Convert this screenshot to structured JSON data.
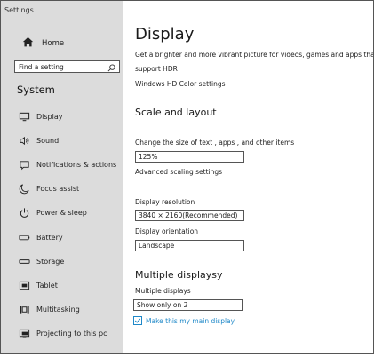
{
  "window": {
    "title": "Settings"
  },
  "sidebar": {
    "home_label": "Home",
    "search_placeholder": "Find a setting",
    "section_title": "System",
    "items": [
      {
        "label": "Display",
        "icon": "monitor-icon"
      },
      {
        "label": "Sound",
        "icon": "speaker-icon"
      },
      {
        "label": "Notifications & actions",
        "icon": "notification-icon"
      },
      {
        "label": "Focus assist",
        "icon": "moon-icon"
      },
      {
        "label": "Power & sleep",
        "icon": "power-icon"
      },
      {
        "label": "Battery",
        "icon": "battery-icon"
      },
      {
        "label": "Storage",
        "icon": "storage-icon"
      },
      {
        "label": "Tablet",
        "icon": "tablet-icon"
      },
      {
        "label": "Multitasking",
        "icon": "multitasking-icon"
      },
      {
        "label": "Projecting to this pc",
        "icon": "projecting-icon"
      }
    ]
  },
  "main": {
    "title": "Display",
    "hdr_desc_line1": "Get a brighter and more vibrant picture for videos, games and apps that",
    "hdr_desc_line2": "support HDR",
    "hdr_link": "Windows HD Color settings",
    "scale_heading": "Scale and layout",
    "scale_label": "Change the size of text , apps , and other items",
    "scale_value": "125%",
    "advanced_link": "Advanced scaling settings",
    "resolution_label": "Display resolution",
    "resolution_value": "3840 × 2160(Recommended)",
    "orientation_label": "Display orientation",
    "orientation_value": "Landscape",
    "multi_heading": "Multiple displaysy",
    "multi_label": "Multiple displays",
    "multi_value": "Show only on 2",
    "main_display_checkbox": "Make this my main display",
    "accent_color": "#1e88c8"
  }
}
